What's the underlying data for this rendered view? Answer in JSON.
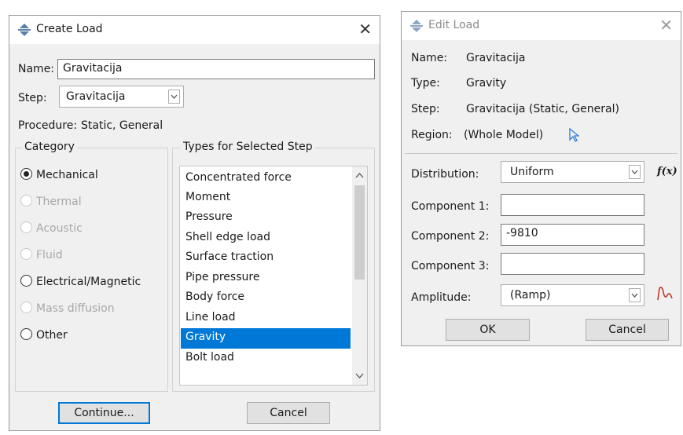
{
  "create_load": {
    "title": "Create Load",
    "name_label": "Name:",
    "name_value": "Gravitacija",
    "step_label": "Step:",
    "step_value": "Gravitacija",
    "procedure_label": "Procedure:",
    "procedure_value": "Static, General",
    "category_title": "Category",
    "categories": [
      {
        "label": "Mechanical",
        "selected": true,
        "enabled": true
      },
      {
        "label": "Thermal",
        "selected": false,
        "enabled": false
      },
      {
        "label": "Acoustic",
        "selected": false,
        "enabled": false
      },
      {
        "label": "Fluid",
        "selected": false,
        "enabled": false
      },
      {
        "label": "Electrical/Magnetic",
        "selected": false,
        "enabled": true
      },
      {
        "label": "Mass diffusion",
        "selected": false,
        "enabled": false
      },
      {
        "label": "Other",
        "selected": false,
        "enabled": true
      }
    ],
    "types_title": "Types for Selected Step",
    "types": [
      "Concentrated force",
      "Moment",
      "Pressure",
      "Shell edge load",
      "Surface traction",
      "Pipe pressure",
      "Body force",
      "Line load",
      "Gravity",
      "Bolt load"
    ],
    "selected_type": "Gravity",
    "continue_label": "Continue...",
    "cancel_label": "Cancel"
  },
  "edit_load": {
    "title": "Edit Load",
    "name_label": "Name:",
    "name_value": "Gravitacija",
    "type_label": "Type:",
    "type_value": "Gravity",
    "step_label": "Step:",
    "step_value": "Gravitacija (Static, General)",
    "region_label": "Region:",
    "region_value": "(Whole Model)",
    "distribution_label": "Distribution:",
    "distribution_value": "Uniform",
    "fx_label": "f(x)",
    "component1_label": "Component 1:",
    "component1_value": "",
    "component2_label": "Component 2:",
    "component2_value": "-9810",
    "component3_label": "Component 3:",
    "component3_value": "",
    "amplitude_label": "Amplitude:",
    "amplitude_value": "(Ramp)",
    "ok_label": "OK",
    "cancel_label": "Cancel"
  },
  "icons": {
    "close": "close-icon",
    "app": "abaqus-load-icon",
    "region_pick": "arrow-cursor-icon",
    "amplitude": "amplitude-curve-icon"
  },
  "colors": {
    "selection": "#0078d7",
    "dialog_bg": "#f0f0f0",
    "amplitude_icon": "#c0392b",
    "cursor_icon": "#2b7de0"
  },
  "close_glyph": "✕"
}
